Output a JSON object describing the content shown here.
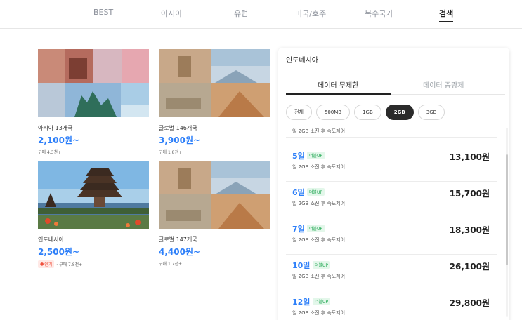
{
  "nav": {
    "tabs": [
      "BEST",
      "아시아",
      "유럽",
      "미국/호주",
      "복수국가",
      "검색"
    ],
    "active_index": 5
  },
  "cards": [
    {
      "name": "아시아 13개국",
      "price": "2,100원~",
      "meta": "구매 4.3천+"
    },
    {
      "name": "글로벌 146개국",
      "price": "3,900원~",
      "meta": "구매 1.8천+"
    },
    {
      "name": "인도네시아",
      "price": "2,500원~",
      "badge": "인기",
      "meta": "· 구매 7.8천+"
    },
    {
      "name": "글로벌 147개국",
      "price": "4,400원~",
      "meta": "구매 1.7천+"
    }
  ],
  "panel": {
    "title": "인도네시아",
    "tabs": {
      "unlimited": "데이터 무제한",
      "fixed": "데이터 종량제"
    },
    "chips": [
      "전체",
      "500MB",
      "1GB",
      "2GB",
      "3GB"
    ],
    "active_chip": "2GB",
    "top_partial_sub": "일 2GB 소진 후 속도제어",
    "plans": [
      {
        "day": "5일",
        "badge": "더블UP",
        "sub": "일 2GB 소진 후 속도제어",
        "price": "13,100원"
      },
      {
        "day": "6일",
        "badge": "더블UP",
        "sub": "일 2GB 소진 후 속도제어",
        "price": "15,700원"
      },
      {
        "day": "7일",
        "badge": "더블UP",
        "sub": "일 2GB 소진 후 속도제어",
        "price": "18,300원"
      },
      {
        "day": "10일",
        "badge": "더블UP",
        "sub": "일 2GB 소진 후 속도제어",
        "price": "26,100원"
      },
      {
        "day": "12일",
        "badge": "더블UP",
        "sub": "일 2GB 소진 후 속도제어",
        "price": "29,800원"
      }
    ]
  },
  "colors": {
    "accent": "#2d7ff9",
    "badge_green": "#16a34a",
    "hot_red": "#f0503c"
  }
}
